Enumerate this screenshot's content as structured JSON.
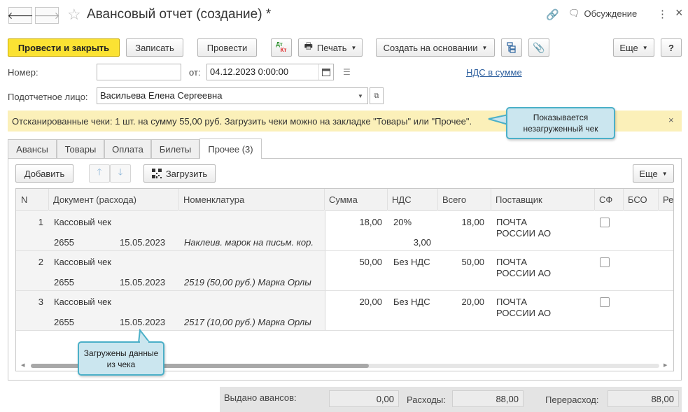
{
  "window": {
    "title": "Авансовый отчет (создание) *",
    "discussion": "Обсуждение",
    "more_icon": "⋮",
    "close_icon": "×"
  },
  "toolbar": {
    "post_close": "Провести и закрыть",
    "save": "Записать",
    "post": "Провести",
    "dtkt_top": "Дт",
    "dtkt_bottom": "Кт",
    "print": "Печать",
    "create_based": "Создать на основании",
    "more": "Еще",
    "help": "?"
  },
  "form": {
    "number_label": "Номер:",
    "number_value": "",
    "from_label": "от:",
    "date_value": "04.12.2023  0:00:00",
    "vat_link": "НДС в сумме",
    "person_label": "Подотчетное лицо:",
    "person_value": "Васильева Елена Сергеевна"
  },
  "banner": {
    "text": "Отсканированные чеки: 1 шт. на сумму 55,00 руб. Загрузить чеки можно на закладке \"Товары\" или \"Прочее\".",
    "close": "×"
  },
  "callouts": {
    "top": "Показывается незагруженный чек",
    "bottom": "Загружены данные из чека"
  },
  "tabs": [
    "Авансы",
    "Товары",
    "Оплата",
    "Билеты",
    "Прочее (3)"
  ],
  "table_toolbar": {
    "add": "Добавить",
    "load": "Загрузить",
    "more": "Еще"
  },
  "table": {
    "columns": [
      "N",
      "Документ (расхода)",
      "Номенклатура",
      "Сумма",
      "НДС",
      "Всего",
      "Поставщик",
      "СФ",
      "БСО",
      "Ре"
    ],
    "rows": [
      {
        "n": "1",
        "doc": "Кассовый чек",
        "num": "2655",
        "date": "15.05.2023",
        "item": "Наклеив. марок на письм. кор.",
        "sum": "18,00",
        "vat": "20%",
        "vat_sum": "3,00",
        "total": "18,00",
        "supplier1": "ПОЧТА",
        "supplier2": "РОССИИ АО"
      },
      {
        "n": "2",
        "doc": "Кассовый чек",
        "num": "2655",
        "date": "15.05.2023",
        "item": "2519 (50,00 руб.) Марка Орлы",
        "sum": "50,00",
        "vat": "Без НДС",
        "vat_sum": "",
        "total": "50,00",
        "supplier1": "ПОЧТА",
        "supplier2": "РОССИИ АО"
      },
      {
        "n": "3",
        "doc": "Кассовый чек",
        "num": "2655",
        "date": "15.05.2023",
        "item": "2517 (10,00 руб.) Марка Орлы",
        "sum": "20,00",
        "vat": "Без НДС",
        "vat_sum": "",
        "total": "20,00",
        "supplier1": "ПОЧТА",
        "supplier2": "РОССИИ АО"
      }
    ]
  },
  "footer": {
    "advances_label": "Выдано авансов:",
    "advances_value": "0,00",
    "expenses_label": "Расходы:",
    "expenses_value": "88,00",
    "overspend_label": "Перерасход:",
    "overspend_value": "88,00"
  },
  "colors": {
    "primary_button": "#fbe233",
    "banner": "#fbf0b9",
    "callout": "#cbe6ef",
    "link": "#2d5f9e"
  }
}
